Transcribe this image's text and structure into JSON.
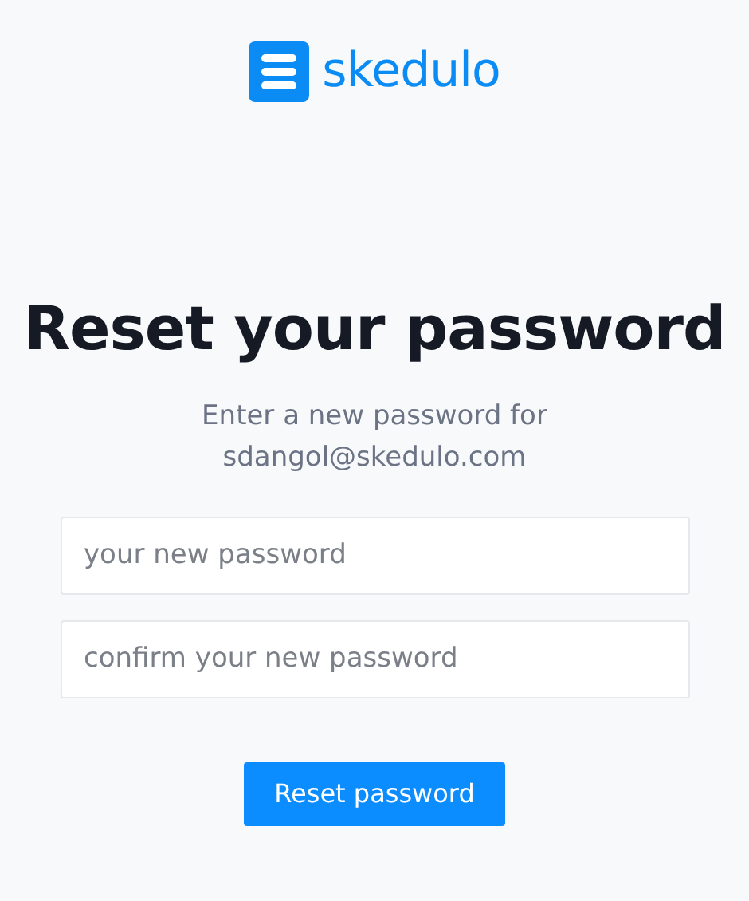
{
  "logo": {
    "text": "skedulo"
  },
  "heading": "Reset your password",
  "subtitle": [
    "Enter a new password for",
    "sdangol@skedulo.com"
  ],
  "fields": [
    {
      "placeholder": "your new password"
    },
    {
      "placeholder": "confirm your new password"
    }
  ],
  "button": "Reset password"
}
